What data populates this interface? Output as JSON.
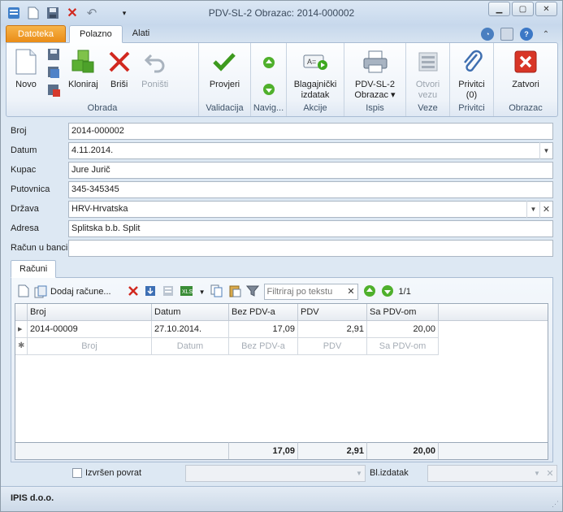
{
  "window": {
    "title": "PDV-SL-2 Obrazac: 2014-000002"
  },
  "ribbon_tabs": [
    "Datoteka",
    "Polazno",
    "Alati"
  ],
  "ribbon": {
    "novo": "Novo",
    "kloniraj": "Kloniraj",
    "brisi": "Briši",
    "ponisti": "Poništi",
    "obrada": "Obrada",
    "provjeri": "Provjeri",
    "validacija": "Validacija",
    "navig": "Navig...",
    "blag_line1": "Blagajnički",
    "blag_line2": "izdatak",
    "akcije": "Akcije",
    "ispis_line1": "PDV-SL-2",
    "ispis_line2": "Obrazac",
    "ispis": "Ispis",
    "otvori_line1": "Otvori",
    "otvori_line2": "vezu",
    "veze": "Veze",
    "privitci_line1": "Privitci",
    "privitci_line2": "(0)",
    "privitci": "Privitci",
    "zatvori": "Zatvori",
    "obrazac": "Obrazac"
  },
  "form": {
    "broj_label": "Broj",
    "broj": "2014-000002",
    "datum_label": "Datum",
    "datum": "4.11.2014.",
    "kupac_label": "Kupac",
    "kupac": "Jure Jurič",
    "putovnica_label": "Putovnica",
    "putovnica": "345-345345",
    "drzava_label": "Država",
    "drzava": "HRV-Hrvatska",
    "adresa_label": "Adresa",
    "adresa": "Splitska b.b. Split",
    "racun_label": "Račun u banci",
    "racun": ""
  },
  "racuni": {
    "tab": "Računi",
    "add_label": "Dodaj račune...",
    "filter_placeholder": "Filtriraj po tekstu",
    "page": "1/1",
    "columns": [
      "Broj",
      "Datum",
      "Bez PDV-a",
      "PDV",
      "Sa PDV-om"
    ],
    "rows": [
      [
        "2014-00009",
        "27.10.2014.",
        "17,09",
        "2,91",
        "20,00"
      ]
    ],
    "totals": [
      "17,09",
      "2,91",
      "20,00"
    ]
  },
  "bottom": {
    "izvrsen_label": "Izvršen povrat",
    "izdatak_label": "Bl.izdatak"
  },
  "status": {
    "company": "IPIS d.o.o."
  }
}
